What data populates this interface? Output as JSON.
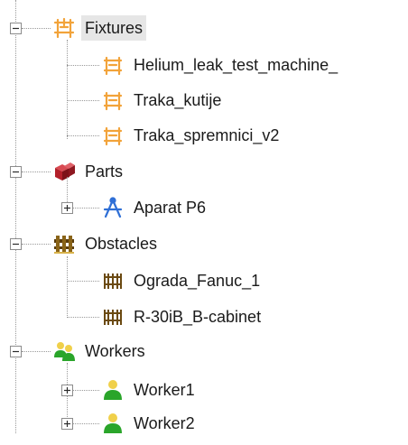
{
  "tree": {
    "fixtures": {
      "label": "Fixtures",
      "icon": "fixture-icon",
      "expanded": true,
      "selected": true,
      "children": [
        {
          "label": "Helium_leak_test_machine_",
          "icon": "fixture-icon"
        },
        {
          "label": "Traka_kutije",
          "icon": "fixture-icon"
        },
        {
          "label": "Traka_spremnici_v2",
          "icon": "fixture-icon"
        }
      ]
    },
    "parts": {
      "label": "Parts",
      "icon": "parts-icon",
      "expanded": true,
      "children": [
        {
          "label": "Aparat P6",
          "icon": "part-compass-icon",
          "expanded": false
        }
      ]
    },
    "obstacles": {
      "label": "Obstacles",
      "icon": "obstacles-icon",
      "expanded": true,
      "children": [
        {
          "label": "Ograda_Fanuc_1",
          "icon": "fence-icon"
        },
        {
          "label": "R-30iB_B-cabinet",
          "icon": "fence-icon"
        }
      ]
    },
    "workers": {
      "label": "Workers",
      "icon": "workers-icon",
      "expanded": true,
      "children": [
        {
          "label": "Worker1",
          "icon": "worker-icon",
          "expanded": false
        },
        {
          "label": "Worker2",
          "icon": "worker-icon",
          "expanded": false
        }
      ]
    }
  },
  "colors": {
    "fixture": "#f2a33a",
    "parts": "#b3202a",
    "compass": "#2f6fd6",
    "fence": "#6b4a12",
    "worker": "#2aa52a",
    "worker_head": "#f0d04a",
    "selection": "#e6e6e6"
  }
}
